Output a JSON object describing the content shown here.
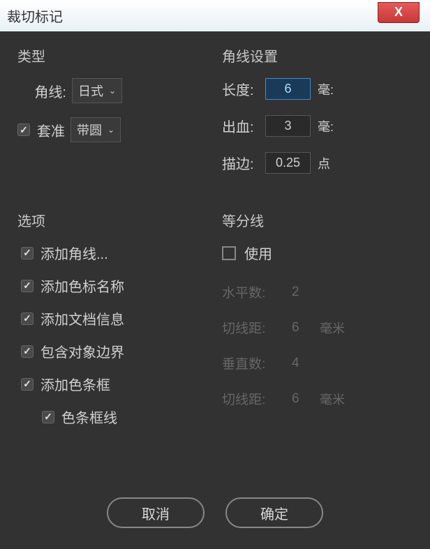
{
  "window": {
    "title": "裁切标记",
    "close": "X"
  },
  "type_group": {
    "label": "类型",
    "corner_label": "角线:",
    "corner_value": "日式",
    "register_label": "套准",
    "register_value": "带圆"
  },
  "corner_settings": {
    "label": "角线设置",
    "length_label": "长度:",
    "length_value": "6",
    "length_unit": "毫:",
    "bleed_label": "出血:",
    "bleed_value": "3",
    "bleed_unit": "毫:",
    "stroke_label": "描边:",
    "stroke_value": "0.25",
    "stroke_unit": "点"
  },
  "options": {
    "label": "选项",
    "items": [
      "添加角线...",
      "添加色标名称",
      "添加文档信息",
      "包含对象边界",
      "添加色条框"
    ],
    "sub_item": "色条框线"
  },
  "divider": {
    "label": "等分线",
    "use_label": "使用",
    "rows": [
      {
        "label": "水平数:",
        "value": "2",
        "unit": ""
      },
      {
        "label": "切线距:",
        "value": "6",
        "unit": "毫米"
      },
      {
        "label": "垂直数:",
        "value": "4",
        "unit": ""
      },
      {
        "label": "切线距:",
        "value": "6",
        "unit": "毫米"
      }
    ]
  },
  "buttons": {
    "cancel": "取消",
    "ok": "确定"
  }
}
